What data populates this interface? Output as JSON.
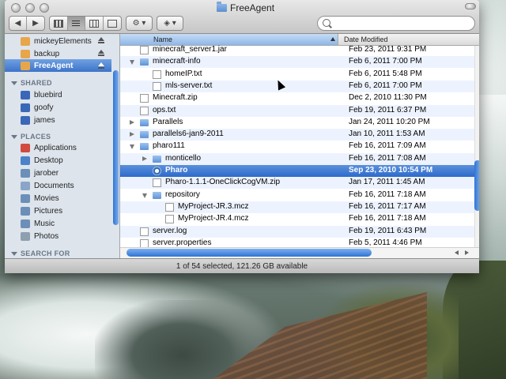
{
  "window": {
    "title": "FreeAgent",
    "status": "1 of 54 selected, 121.26 GB available"
  },
  "toolbar": {
    "back_label": "◀",
    "forward_label": "▶",
    "action_label": "⚙ ▾",
    "dropbox_label": "◈ ▾",
    "search_placeholder": ""
  },
  "sidebar": {
    "devices": [
      {
        "label": "mickeyElements",
        "icon": "folder-icon",
        "color": "#e8a64a",
        "eject": true
      },
      {
        "label": "backup",
        "icon": "folder-icon",
        "color": "#e8a64a",
        "eject": true
      },
      {
        "label": "FreeAgent",
        "icon": "folder-icon",
        "color": "#e8a64a",
        "eject": true,
        "selected": true
      }
    ],
    "shared_header": "SHARED",
    "shared": [
      {
        "label": "bluebird",
        "icon": "computer-icon",
        "color": "#3a67b7"
      },
      {
        "label": "goofy",
        "icon": "computer-icon",
        "color": "#3a67b7"
      },
      {
        "label": "james",
        "icon": "computer-icon",
        "color": "#3a67b7"
      }
    ],
    "places_header": "PLACES",
    "places": [
      {
        "label": "Applications",
        "icon": "applications-icon",
        "color": "#d14b3f"
      },
      {
        "label": "Desktop",
        "icon": "desktop-icon",
        "color": "#4c82c8"
      },
      {
        "label": "jarober",
        "icon": "home-icon",
        "color": "#6b8fb8"
      },
      {
        "label": "Documents",
        "icon": "documents-icon",
        "color": "#8aa5c8"
      },
      {
        "label": "Movies",
        "icon": "movies-icon",
        "color": "#6b8fb8"
      },
      {
        "label": "Pictures",
        "icon": "pictures-icon",
        "color": "#6b8fb8"
      },
      {
        "label": "Music",
        "icon": "music-icon",
        "color": "#6b8fb8"
      },
      {
        "label": "Photos",
        "icon": "photos-icon",
        "color": "#8e9faf"
      }
    ],
    "search_header": "SEARCH FOR"
  },
  "list": {
    "columns": {
      "name": "Name",
      "date": "Date Modified"
    },
    "rows": [
      {
        "name": "minecraft_server1.jar",
        "date": "Feb 23, 2011 9:31 PM",
        "kind": "doc",
        "depth": 0,
        "disc": ""
      },
      {
        "name": "minecraft-info",
        "date": "Feb 6, 2011 7:00 PM",
        "kind": "folder",
        "depth": 0,
        "disc": "open"
      },
      {
        "name": "homeIP.txt",
        "date": "Feb 6, 2011 5:48 PM",
        "kind": "doc",
        "depth": 1,
        "disc": ""
      },
      {
        "name": "mls-server.txt",
        "date": "Feb 6, 2011 7:00 PM",
        "kind": "doc",
        "depth": 1,
        "disc": ""
      },
      {
        "name": "Minecraft.zip",
        "date": "Dec 2, 2010 11:30 PM",
        "kind": "doc",
        "depth": 0,
        "disc": ""
      },
      {
        "name": "ops.txt",
        "date": "Feb 19, 2011 6:37 PM",
        "kind": "doc",
        "depth": 0,
        "disc": ""
      },
      {
        "name": "Parallels",
        "date": "Jan 24, 2011 10:20 PM",
        "kind": "folder",
        "depth": 0,
        "disc": "closed"
      },
      {
        "name": "parallels6-jan9-2011",
        "date": "Jan 10, 2011 1:53 AM",
        "kind": "folder",
        "depth": 0,
        "disc": "closed"
      },
      {
        "name": "pharo111",
        "date": "Feb 16, 2011 7:09 AM",
        "kind": "folder",
        "depth": 0,
        "disc": "open"
      },
      {
        "name": "monticello",
        "date": "Feb 16, 2011 7:08 AM",
        "kind": "folder",
        "depth": 1,
        "disc": "closed"
      },
      {
        "name": "Pharo",
        "date": "Sep 23, 2010 10:54 PM",
        "kind": "app",
        "depth": 1,
        "disc": "",
        "selected": true
      },
      {
        "name": "Pharo-1.1.1-OneClickCogVM.zip",
        "date": "Jan 17, 2011 1:45 AM",
        "kind": "doc",
        "depth": 1,
        "disc": ""
      },
      {
        "name": "repository",
        "date": "Feb 16, 2011 7:18 AM",
        "kind": "folder",
        "depth": 1,
        "disc": "open"
      },
      {
        "name": "MyProject-JR.3.mcz",
        "date": "Feb 16, 2011 7:17 AM",
        "kind": "doc",
        "depth": 2,
        "disc": ""
      },
      {
        "name": "MyProject-JR.4.mcz",
        "date": "Feb 16, 2011 7:18 AM",
        "kind": "doc",
        "depth": 2,
        "disc": ""
      },
      {
        "name": "server.log",
        "date": "Feb 19, 2011 6:43 PM",
        "kind": "doc",
        "depth": 0,
        "disc": ""
      },
      {
        "name": "server.properties",
        "date": "Feb 5, 2011 4:46 PM",
        "kind": "doc",
        "depth": 0,
        "disc": ""
      }
    ]
  }
}
